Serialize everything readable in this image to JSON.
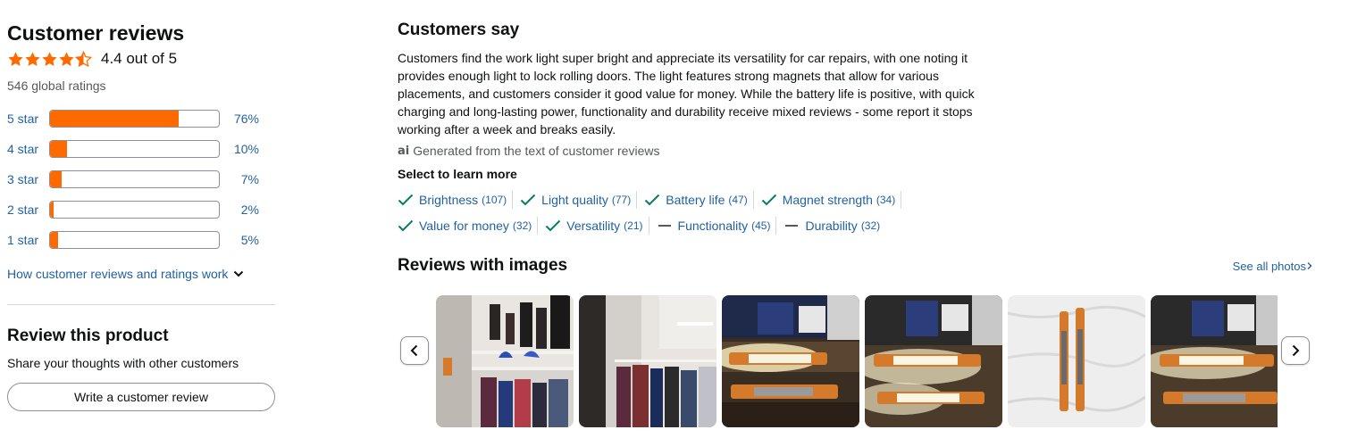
{
  "summary": {
    "title": "Customer reviews",
    "rating_value": 4.4,
    "rating_text": "4.4 out of 5",
    "global_ratings": "546 global ratings",
    "histogram": [
      {
        "label": "5 star",
        "percent": 76,
        "percent_text": "76%"
      },
      {
        "label": "4 star",
        "percent": 10,
        "percent_text": "10%"
      },
      {
        "label": "3 star",
        "percent": 7,
        "percent_text": "7%"
      },
      {
        "label": "2 star",
        "percent": 2,
        "percent_text": "2%"
      },
      {
        "label": "1 star",
        "percent": 5,
        "percent_text": "5%"
      }
    ],
    "how_link": "How customer reviews and ratings work",
    "accent_color": "#ff6a00"
  },
  "review_product": {
    "title": "Review this product",
    "subtitle": "Share your thoughts with other customers",
    "button_label": "Write a customer review"
  },
  "customers_say": {
    "title": "Customers say",
    "body": "Customers find the work light super bright and appreciate its versatility for car repairs, with one noting it provides enough light to lock rolling doors. The light features strong magnets that allow for various placements, and customers consider it good value for money. While the battery life is positive, with quick charging and long-lasting power, functionality and durability receive mixed reviews - some report it stops working after a week and breaks easily.",
    "ai_badge": "ai",
    "ai_note": "Generated from the text of customer reviews",
    "select_heading": "Select to learn more",
    "aspects": [
      {
        "label": "Brightness",
        "count": "(107)",
        "sentiment": "positive"
      },
      {
        "label": "Light quality",
        "count": "(77)",
        "sentiment": "positive"
      },
      {
        "label": "Battery life",
        "count": "(47)",
        "sentiment": "positive"
      },
      {
        "label": "Magnet strength",
        "count": "(34)",
        "sentiment": "positive"
      },
      {
        "label": "Value for money",
        "count": "(32)",
        "sentiment": "positive"
      },
      {
        "label": "Versatility",
        "count": "(21)",
        "sentiment": "positive"
      },
      {
        "label": "Functionality",
        "count": "(45)",
        "sentiment": "mixed"
      },
      {
        "label": "Durability",
        "count": "(32)",
        "sentiment": "mixed"
      }
    ]
  },
  "reviews_with_images": {
    "title": "Reviews with images",
    "see_all": "See all photos",
    "thumbnails": [
      "closet-shoes-photo",
      "closet-clothes-photo",
      "work-light-box-photo",
      "work-light-lit-photo",
      "work-lights-on-sheet-photo",
      "work-light-box-photo-2"
    ]
  }
}
